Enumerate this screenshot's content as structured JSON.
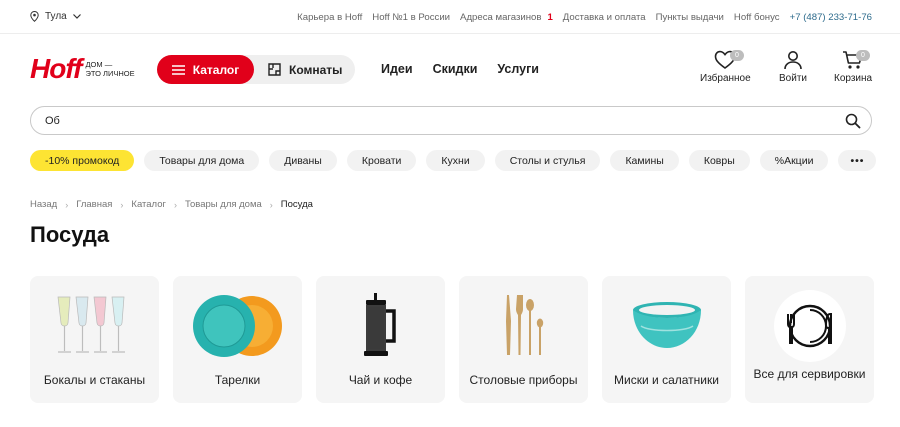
{
  "topbar": {
    "city": "Тула",
    "links": {
      "career": "Карьера в Hoff",
      "number_one": "Hoff №1 в России",
      "stores": "Адреса магазинов",
      "stores_count": "1",
      "delivery": "Доставка и оплата",
      "pickup": "Пункты выдачи",
      "bonus": "Hoff бонус"
    },
    "phone": "+7 (487) 233-71-76"
  },
  "header": {
    "logo_word": "Hoff",
    "logo_tagline_1": "дом —",
    "logo_tagline_2": "это личное",
    "catalog_label": "Каталог",
    "rooms_label": "Комнаты",
    "nav": [
      "Идеи",
      "Скидки",
      "Услуги"
    ],
    "favorites": {
      "label": "Избранное",
      "count": "0"
    },
    "login": {
      "label": "Войти"
    },
    "cart": {
      "label": "Корзина",
      "count": "0"
    }
  },
  "search": {
    "value": "Об",
    "placeholder": ""
  },
  "chips": [
    "-10% промокод",
    "Товары для дома",
    "Диваны",
    "Кровати",
    "Кухни",
    "Столы и стулья",
    "Камины",
    "Ковры",
    "%Акции",
    "•••"
  ],
  "breadcrumb": [
    "Назад",
    "Главная",
    "Каталог",
    "Товары для дома",
    "Посуда"
  ],
  "page_title": "Посуда",
  "categories": [
    "Бокалы и стаканы",
    "Тарелки",
    "Чай и кофе",
    "Столовые приборы",
    "Миски и салатники",
    "Все для сервировки"
  ],
  "colors": {
    "brand_red": "#e1001a",
    "promo_yellow": "#fde433",
    "chip_bg": "#f2f2f2",
    "card_bg": "#f5f5f5",
    "phone_blue": "#2d6b8c"
  }
}
